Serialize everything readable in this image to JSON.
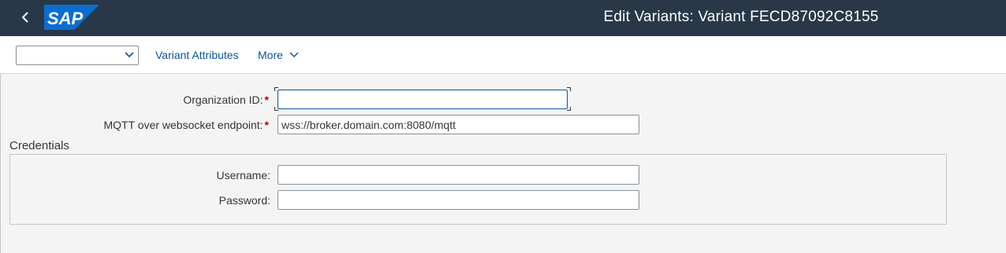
{
  "shell": {
    "title": "Edit Variants: Variant FECD87092C8155",
    "logo_text": "SAP",
    "logo_color": "#0a6ed1",
    "background": "#283848"
  },
  "toolbar": {
    "variant_select_value": "",
    "variant_attributes_label": "Variant Attributes",
    "more_label": "More"
  },
  "form": {
    "organization_id": {
      "label": "Organization ID:",
      "required": "*",
      "value": ""
    },
    "mqtt_endpoint": {
      "label": "MQTT over websocket endpoint:",
      "required": "*",
      "value": "wss://broker.domain.com:8080/mqtt"
    }
  },
  "credentials": {
    "title": "Credentials",
    "username": {
      "label": "Username:",
      "value": ""
    },
    "password": {
      "label": "Password:",
      "value": ""
    }
  }
}
